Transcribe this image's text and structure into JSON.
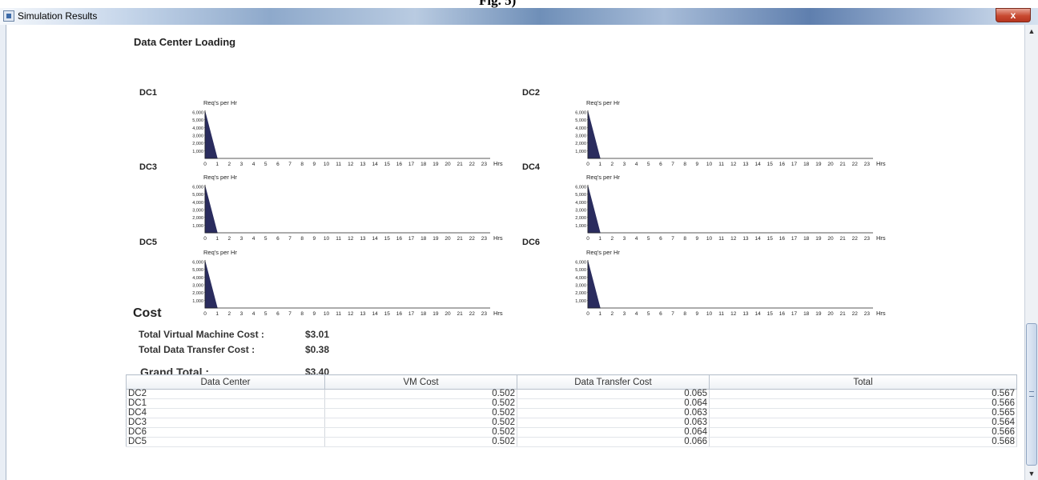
{
  "top_caption": "Fig. 5)",
  "window": {
    "title": "Simulation Results",
    "close_label": "x"
  },
  "loading": {
    "section_title": "Data Center Loading",
    "y_axis_label": "Req's per Hr",
    "x_axis_unit": "Hrs",
    "y_ticks": [
      "6,000",
      "5,000",
      "4,000",
      "3,000",
      "2,000",
      "1,000"
    ],
    "x_ticks": [
      "0",
      "1",
      "2",
      "3",
      "4",
      "5",
      "6",
      "7",
      "8",
      "9",
      "10",
      "11",
      "12",
      "13",
      "14",
      "15",
      "16",
      "17",
      "18",
      "19",
      "20",
      "21",
      "22",
      "23"
    ]
  },
  "chart_data": [
    {
      "type": "area",
      "title": "DC1",
      "ylabel": "Req's per Hr",
      "xlabel": "Hrs",
      "ylim": [
        0,
        6000
      ],
      "x": [
        0,
        1
      ],
      "y": [
        6000,
        0
      ]
    },
    {
      "type": "area",
      "title": "DC2",
      "ylabel": "Req's per Hr",
      "xlabel": "Hrs",
      "ylim": [
        0,
        6000
      ],
      "x": [
        0,
        1
      ],
      "y": [
        6000,
        0
      ]
    },
    {
      "type": "area",
      "title": "DC3",
      "ylabel": "Req's per Hr",
      "xlabel": "Hrs",
      "ylim": [
        0,
        6000
      ],
      "x": [
        0,
        1
      ],
      "y": [
        6000,
        0
      ]
    },
    {
      "type": "area",
      "title": "DC4",
      "ylabel": "Req's per Hr",
      "xlabel": "Hrs",
      "ylim": [
        0,
        6000
      ],
      "x": [
        0,
        1
      ],
      "y": [
        6000,
        0
      ]
    },
    {
      "type": "area",
      "title": "DC5",
      "ylabel": "Req's per Hr",
      "xlabel": "Hrs",
      "ylim": [
        0,
        6000
      ],
      "x": [
        0,
        1
      ],
      "y": [
        6000,
        0
      ]
    },
    {
      "type": "area",
      "title": "DC6",
      "ylabel": "Req's per Hr",
      "xlabel": "Hrs",
      "ylim": [
        0,
        6000
      ],
      "x": [
        0,
        1
      ],
      "y": [
        6000,
        0
      ]
    }
  ],
  "cost": {
    "section_title": "Cost",
    "vm_label": "Total Virtual Machine Cost :",
    "vm_value": "$3.01",
    "transfer_label": "Total Data Transfer Cost :",
    "transfer_value": "$0.38",
    "grand_label": "Grand Total :",
    "grand_value": "$3.40"
  },
  "table": {
    "columns": [
      "Data Center",
      "VM Cost",
      "Data Transfer Cost",
      "Total"
    ],
    "rows": [
      [
        "DC2",
        "0.502",
        "0.065",
        "0.567"
      ],
      [
        "DC1",
        "0.502",
        "0.064",
        "0.566"
      ],
      [
        "DC4",
        "0.502",
        "0.063",
        "0.565"
      ],
      [
        "DC3",
        "0.502",
        "0.063",
        "0.564"
      ],
      [
        "DC6",
        "0.502",
        "0.064",
        "0.566"
      ],
      [
        "DC5",
        "0.502",
        "0.066",
        "0.568"
      ]
    ]
  },
  "icons": {
    "app": "java-app-icon",
    "close": "close-icon",
    "scroll_up": "arrow-up-icon",
    "scroll_down": "arrow-down-icon"
  },
  "colors": {
    "area_fill": "#2a2c5e",
    "close_button": "#c84a31"
  }
}
